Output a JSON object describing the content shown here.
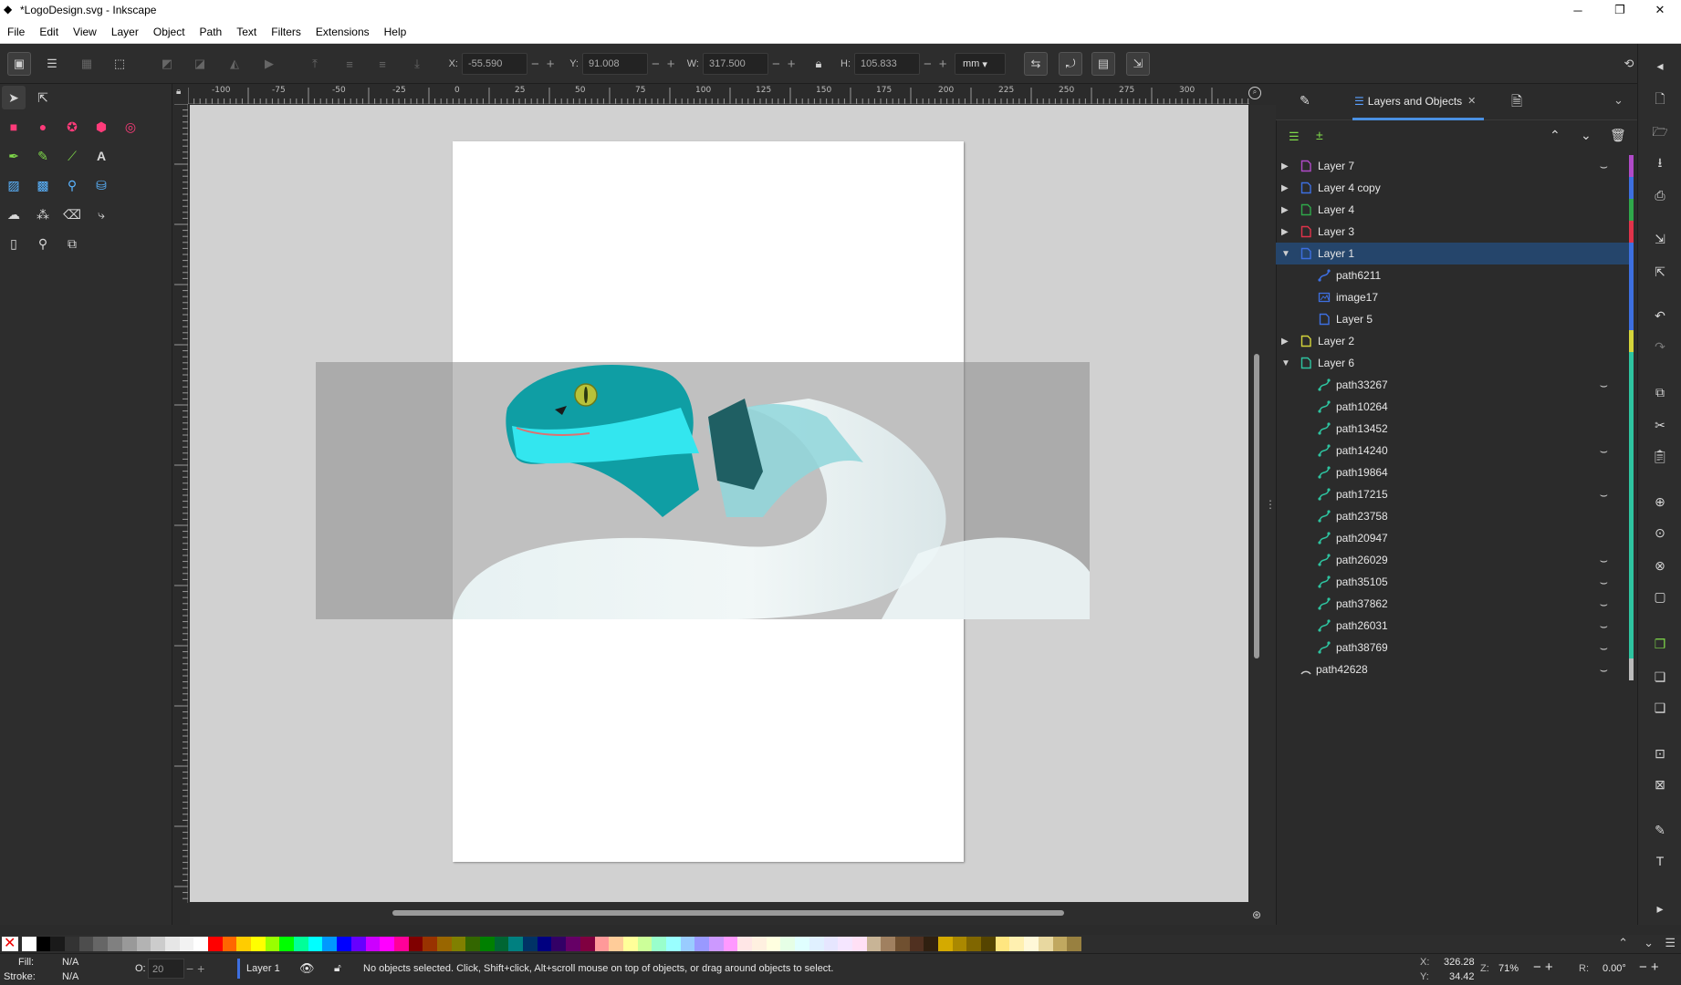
{
  "window": {
    "title": "*LogoDesign.svg - Inkscape",
    "min": "─",
    "max": "❐",
    "close": "✕"
  },
  "menu": [
    "File",
    "Edit",
    "View",
    "Layer",
    "Object",
    "Path",
    "Text",
    "Filters",
    "Extensions",
    "Help"
  ],
  "controls": {
    "x_label": "X:",
    "x_value": "-55.590",
    "y_label": "Y:",
    "y_value": "91.008",
    "w_label": "W:",
    "w_value": "317.500",
    "h_label": "H:",
    "h_value": "105.833",
    "unit": "mm"
  },
  "ruler": {
    "h_ticks": [
      "-100",
      "-75",
      "-50",
      "-25",
      "0",
      "25",
      "50",
      "75",
      "100",
      "125",
      "150",
      "175",
      "200",
      "225",
      "250",
      "275",
      "300"
    ],
    "v_ticks": [
      "0",
      "2",
      "5",
      "7",
      "1",
      "1",
      "1",
      "1",
      "2",
      "2",
      "2",
      "2",
      "3"
    ]
  },
  "dock": {
    "active_tab": "Layers and Objects",
    "tab_close": "✕"
  },
  "layers": [
    {
      "name": "Layer 7",
      "arrow": "▶",
      "color": "#b04ac8",
      "eye": "hidden"
    },
    {
      "name": "Layer 4 copy",
      "arrow": "▶",
      "color": "#3d6fe0",
      "eye": ""
    },
    {
      "name": "Layer 4",
      "arrow": "▶",
      "color": "#2fa84a",
      "eye": ""
    },
    {
      "name": "Layer 3",
      "arrow": "▶",
      "color": "#e0334a",
      "eye": ""
    },
    {
      "name": "Layer 1",
      "arrow": "▼",
      "color": "#3d6fe0",
      "eye": "",
      "selected": true
    },
    {
      "name": "path6211",
      "child": true,
      "color": "#3d6fe0",
      "eye": ""
    },
    {
      "name": "image17",
      "child": true,
      "color": "#3d6fe0",
      "eye": ""
    },
    {
      "name": "Layer 5",
      "child": true,
      "color": "#3d6fe0",
      "eye": ""
    },
    {
      "name": "Layer 2",
      "arrow": "▶",
      "color": "#d4d43a",
      "eye": ""
    },
    {
      "name": "Layer 6",
      "arrow": "▼",
      "color": "#2ec4a0",
      "eye": ""
    },
    {
      "name": "path33267",
      "child": true,
      "color": "#2ec4a0",
      "eye": "hidden"
    },
    {
      "name": "path10264",
      "child": true,
      "color": "#2ec4a0",
      "eye": ""
    },
    {
      "name": "path13452",
      "child": true,
      "color": "#2ec4a0",
      "eye": ""
    },
    {
      "name": "path14240",
      "child": true,
      "color": "#2ec4a0",
      "eye": "hidden"
    },
    {
      "name": "path19864",
      "child": true,
      "color": "#2ec4a0",
      "eye": ""
    },
    {
      "name": "path17215",
      "child": true,
      "color": "#2ec4a0",
      "eye": "hidden"
    },
    {
      "name": "path23758",
      "child": true,
      "color": "#2ec4a0",
      "eye": ""
    },
    {
      "name": "path20947",
      "child": true,
      "color": "#2ec4a0",
      "eye": ""
    },
    {
      "name": "path26029",
      "child": true,
      "color": "#2ec4a0",
      "eye": "hidden"
    },
    {
      "name": "path35105",
      "child": true,
      "color": "#2ec4a0",
      "eye": "hidden"
    },
    {
      "name": "path37862",
      "child": true,
      "color": "#2ec4a0",
      "eye": "hidden"
    },
    {
      "name": "path26031",
      "child": true,
      "color": "#2ec4a0",
      "eye": "hidden"
    },
    {
      "name": "path38769",
      "child": true,
      "color": "#2ec4a0",
      "eye": "hidden"
    },
    {
      "name": "path42628",
      "arc": true,
      "color": "#bbbbbb",
      "eye": "hidden"
    }
  ],
  "status": {
    "fill_label": "Fill:",
    "fill_value": "N/A",
    "stroke_label": "Stroke:",
    "stroke_value": "N/A",
    "opacity_label": "O:",
    "opacity_value": "20",
    "layer": "Layer 1",
    "message": "No objects selected. Click, Shift+click, Alt+scroll mouse on top of objects, or drag around objects to select.",
    "x_label": "X:",
    "x_value": "326.28",
    "y_label": "Y:",
    "y_value": "34.42",
    "zoom_label": "Z:",
    "zoom_value": "71%",
    "rot_label": "R:",
    "rot_value": "0.00°"
  },
  "palette": [
    "#ffffff",
    "#000000",
    "#1a1a1a",
    "#333333",
    "#4d4d4d",
    "#666666",
    "#808080",
    "#999999",
    "#b3b3b3",
    "#cccccc",
    "#e6e6e6",
    "#f2f2f2",
    "#ffffff",
    "#ff0000",
    "#ff6600",
    "#ffcc00",
    "#ffff00",
    "#99ff00",
    "#00ff00",
    "#00ff99",
    "#00ffff",
    "#0099ff",
    "#0000ff",
    "#6600ff",
    "#cc00ff",
    "#ff00ff",
    "#ff0099",
    "#800000",
    "#993300",
    "#996600",
    "#808000",
    "#336600",
    "#008000",
    "#006633",
    "#008080",
    "#003366",
    "#000080",
    "#330066",
    "#660066",
    "#800040",
    "#ff9999",
    "#ffcc99",
    "#ffff99",
    "#ccff99",
    "#99ffcc",
    "#99ffff",
    "#99ccff",
    "#9999ff",
    "#cc99ff",
    "#ff99ff",
    "#ffe6e6",
    "#fff0e0",
    "#ffffe0",
    "#e6ffe6",
    "#e0ffff",
    "#e0f0ff",
    "#e6e6ff",
    "#f5e6ff",
    "#ffe0f5",
    "#c8b496",
    "#a08060",
    "#705030",
    "#503020",
    "#302010",
    "#d4aa00",
    "#aa8800",
    "#806600",
    "#554400",
    "#ffe680",
    "#fff0b0",
    "#fff8d8",
    "#e8d8a0",
    "#c0a860",
    "#988040"
  ]
}
